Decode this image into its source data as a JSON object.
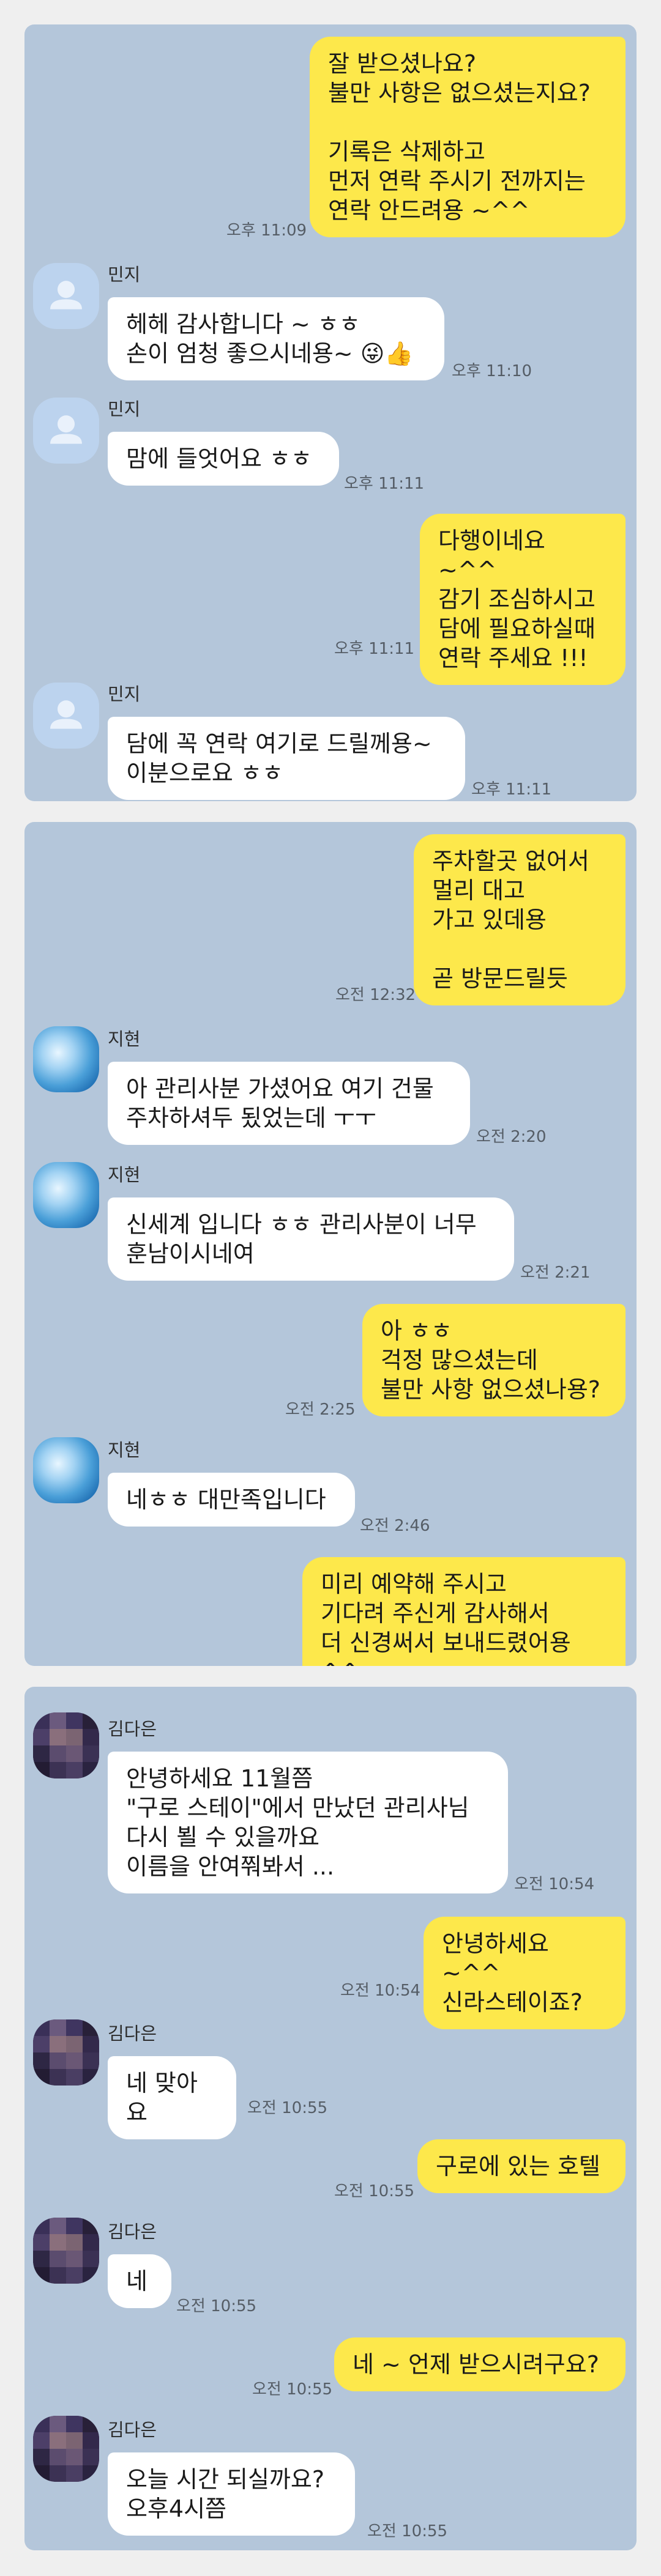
{
  "panels": [
    {
      "messages": [
        {
          "side": "me",
          "text": "잘 받으셨나요?\n불만 사항은 없으셨는지요?\n\n기록은 삭제하고\n먼저 연락 주시기 전까지는\n연락 안드려용 ~^^",
          "time": "오후 11:09"
        },
        {
          "side": "them",
          "sender": "민지",
          "text": "헤헤 감사합니다 ~ ㅎㅎ\n손이 엄청 좋으시네용~ 😜👍",
          "time": "오후 11:10"
        },
        {
          "side": "them",
          "sender": "민지",
          "text": "맘에 들엇어요 ㅎㅎ",
          "time": "오후 11:11"
        },
        {
          "side": "me",
          "text": "다행이네요 ~^^\n감기 조심하시고\n담에 필요하실때\n연락 주세요 !!!",
          "time": "오후 11:11"
        },
        {
          "side": "them",
          "sender": "민지",
          "text": "담에 꼭 연락 여기로 드릴께용~\n이분으로요 ㅎㅎ",
          "time": "오후 11:11"
        }
      ]
    },
    {
      "messages": [
        {
          "side": "me",
          "text": "주차할곳 없어서\n멀리 대고\n가고 있데용\n\n곧 방문드릴듯",
          "time": "오전 12:32"
        },
        {
          "side": "them",
          "sender": "지현",
          "text": "아 관리사분 가셨어요 여기 건물\n주차하셔두 됬었는데 ㅜㅜ",
          "time": "오전 2:20"
        },
        {
          "side": "them",
          "sender": "지현",
          "text": "신세계 입니다 ㅎㅎ 관리사분이 너무\n훈남이시네여",
          "time": "오전 2:21"
        },
        {
          "side": "me",
          "text": "아 ㅎㅎ\n걱정 많으셨는데\n불만 사항 없으셨나용?",
          "time": "오전 2:25"
        },
        {
          "side": "them",
          "sender": "지현",
          "text": "네ㅎㅎ 대만족입니다",
          "time": "오전 2:46"
        },
        {
          "side": "me",
          "text": "미리 예약해 주시고\n기다려 주신게 감사해서\n더 신경써서 보내드렸어용 ^^",
          "time": ""
        }
      ]
    },
    {
      "messages": [
        {
          "side": "them",
          "sender": "김다은",
          "text": "안녕하세요 11월쯤\n\"구로 스테이\"에서 만났던 관리사님\n다시 뵐 수 있을까요\n이름을 안여쭤봐서 ...",
          "time": "오전 10:54"
        },
        {
          "side": "me",
          "text": "안녕하세요 ~^^\n신라스테이죠?",
          "time": "오전 10:54"
        },
        {
          "side": "them",
          "sender": "김다은",
          "text": "네 맞아요",
          "time": "오전 10:55"
        },
        {
          "side": "me",
          "text": "구로에 있는 호텔",
          "time": "오전 10:55"
        },
        {
          "side": "them",
          "sender": "김다은",
          "text": "네",
          "time": "오전 10:55"
        },
        {
          "side": "me",
          "text": "네 ~ 언제 받으시려구요?",
          "time": "오전 10:55"
        },
        {
          "side": "them",
          "sender": "김다은",
          "text": "오늘 시간 되실까요?\n오후4시쯤",
          "time": "오전 10:55"
        }
      ]
    }
  ],
  "avatars": {
    "민지": "person-icon",
    "지현": "sky-photo",
    "김다은": "pixelated-photo"
  },
  "colors": {
    "panel": "#b4c6da",
    "my_bubble": "#fde84b",
    "their_bubble": "#ffffff",
    "time": "#555d66"
  }
}
